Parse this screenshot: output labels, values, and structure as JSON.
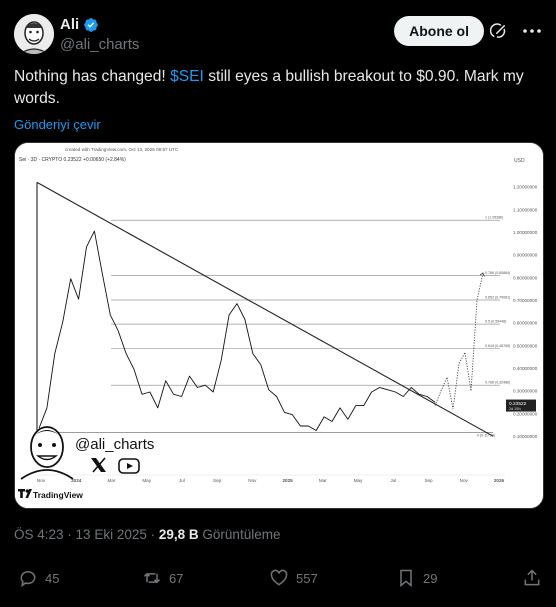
{
  "author": {
    "display_name": "Ali",
    "handle": "@ali_charts",
    "verified_color": "#1d9bf0"
  },
  "follow_label": "Abone ol",
  "tweet": {
    "text_before": "Nothing has changed! ",
    "cashtag": "$SEI",
    "text_after": " still eyes a bullish breakout to $0.90. Mark my words."
  },
  "translate_label": "Gönderiyi çevir",
  "chart": {
    "created_with": "created with TradingView.com, Oct 13, 2025 09:57 UTC",
    "symbol_line": "Sei · 3D · CRYPTO   0.23522   +0.00650 (+2.84%)",
    "currency": "USD",
    "watermark_handle": "@ali_charts",
    "brand": "TradingView",
    "last_price": "0.23522",
    "last_price_sub": "2d 15h",
    "fib_labels": [
      "1 (1.05286)",
      "0.786 (0.80884)",
      "0.652 (0.70081)",
      "0.5 (0.59448)",
      "0.618 (0.48765)",
      "0.786 (0.32486)"
    ],
    "bottom_label": "0 (0.11713)"
  },
  "chart_data": {
    "type": "line",
    "title": "Sei · 3D · CRYPTO",
    "x_ticks": [
      "Nov",
      "2024",
      "Mar",
      "May",
      "Jul",
      "Sep",
      "Nov",
      "2025",
      "Mar",
      "May",
      "Jul",
      "Sep",
      "Nov",
      "2026"
    ],
    "y_ticks": [
      1.2,
      1.1,
      1.0,
      0.9,
      0.8,
      0.7,
      0.6,
      0.5,
      0.4,
      0.3,
      0.2,
      0.1
    ],
    "ylim": [
      0.07,
      1.27
    ],
    "series": [
      {
        "values": [
          0.12,
          0.24,
          0.45,
          0.62,
          0.78,
          0.72,
          0.92,
          1.02,
          0.8,
          0.65,
          0.55,
          0.48,
          0.38,
          0.3,
          0.28,
          0.24,
          0.33,
          0.3,
          0.26,
          0.38,
          0.3,
          0.34,
          0.28,
          0.45,
          0.62,
          0.7,
          0.6,
          0.48,
          0.4,
          0.32,
          0.26,
          0.22,
          0.18,
          0.16,
          0.13,
          0.14,
          0.17,
          0.18,
          0.21,
          0.19,
          0.22,
          0.25,
          0.28,
          0.33,
          0.29,
          0.31,
          0.26,
          0.33,
          0.27,
          0.29,
          0.235
        ]
      }
    ],
    "projection": [
      0.235,
      0.3,
      0.36,
      0.22,
      0.42,
      0.47,
      0.3,
      0.7,
      0.82
    ]
  },
  "meta": {
    "time": "ÖS 4:23",
    "date": "13 Eki 2025",
    "views_count": "29,8 B",
    "views_label": "Görüntüleme"
  },
  "actions": {
    "replies": "45",
    "reposts": "67",
    "likes": "557",
    "bookmarks": "29"
  }
}
